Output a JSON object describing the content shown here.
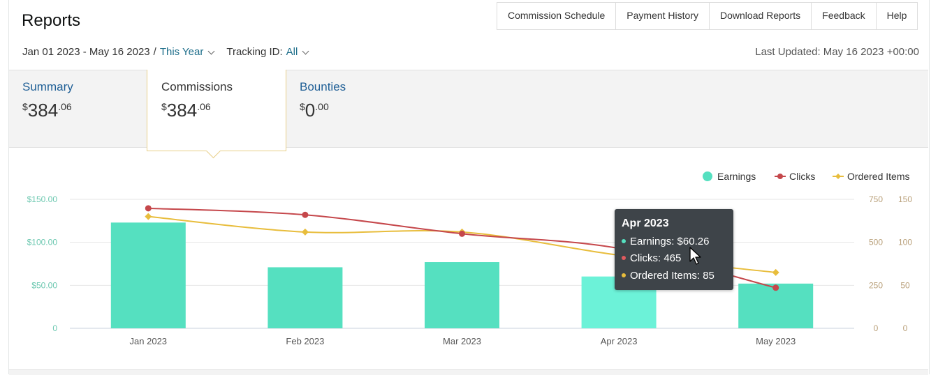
{
  "header": {
    "title": "Reports",
    "nav": [
      "Commission Schedule",
      "Payment History",
      "Download Reports",
      "Feedback",
      "Help"
    ],
    "date_range": "Jan 01 2023 - May 16 2023",
    "date_slash": "/",
    "period": "This Year",
    "tracking_label": "Tracking ID:",
    "tracking_value": "All",
    "last_updated": "Last Updated: May 16 2023 +00:00"
  },
  "tabs": [
    {
      "label": "Summary",
      "currency": "$",
      "int": "384",
      "dec": ".06"
    },
    {
      "label": "Commissions",
      "currency": "$",
      "int": "384",
      "dec": ".06"
    },
    {
      "label": "Bounties",
      "currency": "$",
      "int": "0",
      "dec": ".00"
    }
  ],
  "tooltip": {
    "title": "Apr 2023",
    "rows": [
      "Earnings: $60.26",
      "Clicks: 465",
      "Ordered Items: 85"
    ]
  },
  "colors": {
    "earnings": "#55e0c0",
    "earnings_hover": "#6cf2d8",
    "clicks": "#c5474b",
    "ordered": "#e8bd3c",
    "left_axis": "#6cc8b0",
    "right_axis": "#b9a07a"
  },
  "chart_data": {
    "type": "bar",
    "categories": [
      "Jan 2023",
      "Feb 2023",
      "Mar 2023",
      "Apr 2023",
      "May 2023"
    ],
    "series": [
      {
        "name": "Earnings",
        "type": "bar",
        "axis": "left",
        "values": [
          123,
          71,
          77,
          60.26,
          52
        ]
      },
      {
        "name": "Clicks",
        "type": "line",
        "axis": "right1",
        "values": [
          698,
          660,
          550,
          465,
          236
        ]
      },
      {
        "name": "Ordered Items",
        "type": "line",
        "axis": "right2",
        "values": [
          130,
          112,
          112,
          85,
          65
        ]
      }
    ],
    "left_axis": {
      "ticks": [
        "0",
        "$50.00",
        "$100.00",
        "$150.00"
      ],
      "ylim": [
        0,
        150
      ]
    },
    "right_axis_1": {
      "ticks": [
        "0",
        "250",
        "500",
        "750"
      ],
      "ylim": [
        0,
        750
      ]
    },
    "right_axis_2": {
      "ticks": [
        "0",
        "50",
        "100",
        "150"
      ],
      "ylim": [
        0,
        150
      ]
    },
    "legend": [
      "Earnings",
      "Clicks",
      "Ordered Items"
    ],
    "legend_position": "top-right",
    "grid": true,
    "highlight_index": 3
  }
}
